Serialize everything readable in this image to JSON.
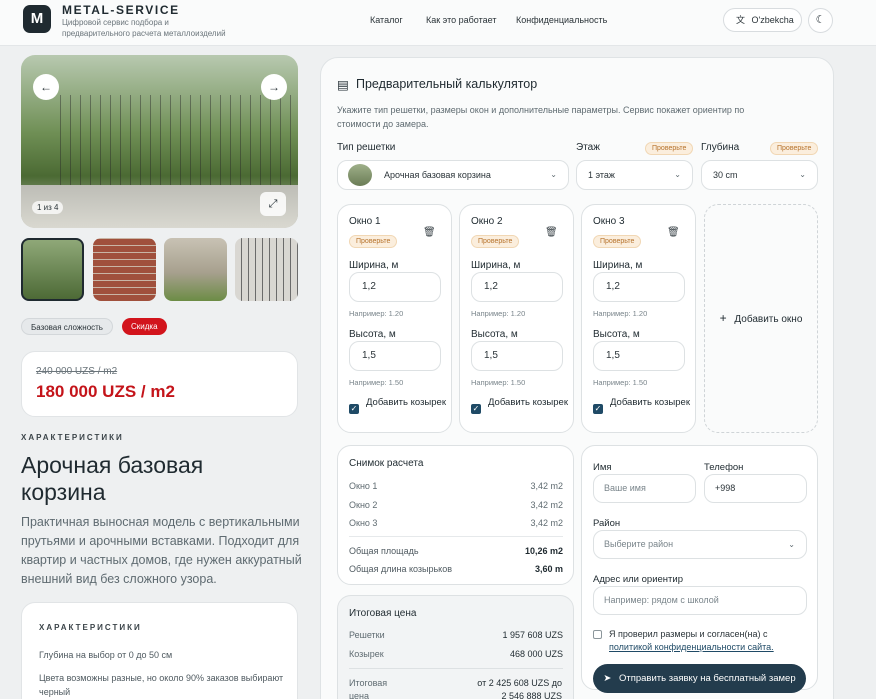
{
  "header": {
    "brand": "METAL-SERVICE",
    "tagline_1": "Цифровой сервис подбора и",
    "tagline_2": "предварительного расчета металлоизделий",
    "nav": [
      "Каталог",
      "Как это работает",
      "Конфиденциальность"
    ],
    "lang_label": "O'zbekcha",
    "lang_icon": "translate-icon",
    "theme_icon": "moon-icon"
  },
  "gallery": {
    "counter": "1 из 4",
    "prev_icon": "arrow-left-icon",
    "next_icon": "arrow-right-icon",
    "fullscreen_icon": "expand-icon"
  },
  "badges": {
    "complexity": "Базовая сложность",
    "discount": "Скидка"
  },
  "price": {
    "old": "240 000 UZS / m2",
    "new": "180 000 UZS / m2"
  },
  "product": {
    "section_label": "ХАРАКТЕРИСТИКИ",
    "title": "Арочная базовая корзина",
    "description": "Практичная выносная модель с вертикальными прутьями и арочными вставками. Подходит для квартир и частных домов, где нужен аккуратный внешний вид без сложного узора.",
    "char_title": "ХАРАКТЕРИСТИКИ",
    "char_items": [
      "Глубина на выбор от 0 до 50 см",
      "Цвета возможны разные, но около 90% заказов выбирают черный"
    ]
  },
  "calculator": {
    "title": "Предварительный калькулятор",
    "title_icon": "calculator-icon",
    "intro": "Укажите тип решетки, размеры окон и дополнительные параметры. Сервис покажет ориентир по стоимости до замера.",
    "type_label": "Тип решетки",
    "type_value": "Арочная базовая корзина",
    "floor_label": "Этаж",
    "floor_value": "1 этаж",
    "depth_label": "Глубина",
    "depth_value": "30 cm",
    "check_badge": "Проверьте",
    "width_label": "Ширина, м",
    "height_label": "Высота, м",
    "canopy_label": "Добавить козырек",
    "add_window": "Добавить окно",
    "windows": [
      {
        "title": "Окно 1",
        "width": "1,2",
        "width_hint": "Например: 1.20",
        "height": "1,5",
        "height_hint": "Например: 1.50"
      },
      {
        "title": "Окно 2",
        "width": "1,2",
        "width_hint": "Например: 1.20",
        "height": "1,5",
        "height_hint": "Например: 1.50"
      },
      {
        "title": "Окно 3",
        "width": "1,2",
        "width_hint": "Например: 1.20",
        "height": "1,5",
        "height_hint": "Например: 1.50"
      }
    ]
  },
  "snapshot": {
    "title": "Снимок расчета",
    "rows": [
      {
        "label": "Окно 1",
        "value": "3,42 m2"
      },
      {
        "label": "Окно 2",
        "value": "3,42 m2"
      },
      {
        "label": "Окно 3",
        "value": "3,42 m2"
      }
    ],
    "area_label": "Общая площадь",
    "area_value": "10,26 m2",
    "canopy_label": "Общая длина козырьков",
    "canopy_value": "3,60 m"
  },
  "total": {
    "title": "Итоговая цена",
    "grates_label": "Решетки",
    "grates_value": "1 957 608 UZS",
    "canopy_label": "Козырек",
    "canopy_value": "468 000 UZS",
    "final_label_1": "Итоговая",
    "final_label_2": "цена",
    "final_value_1": "от 2 425 608 UZS до",
    "final_value_2": "2 546 888 UZS"
  },
  "form": {
    "name_label": "Имя",
    "name_placeholder": "Ваше имя",
    "phone_label": "Телефон",
    "phone_value": "+998",
    "district_label": "Район",
    "district_placeholder": "Выберите район",
    "address_label": "Адрес или ориентир",
    "address_placeholder": "Например: рядом с школой",
    "consent_1": "Я проверил размеры и согласен(на) с",
    "consent_link": "политикой конфиденциальности сайта.",
    "submit": "Отправить заявку на бесплатный замер",
    "submit_icon": "send-icon"
  }
}
